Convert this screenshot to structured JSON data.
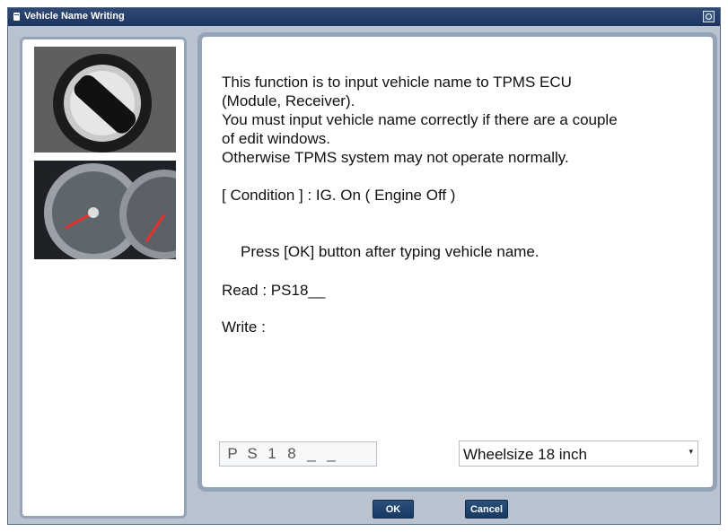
{
  "window": {
    "title": "Vehicle Name Writing",
    "title_icon": "app-icon",
    "close_icon": "close-icon"
  },
  "left_panel": {
    "images": [
      "ignition-switch-image",
      "instrument-cluster-image"
    ]
  },
  "content": {
    "lines": [
      "This function is to input vehicle name to TPMS ECU",
      "(Module, Receiver).",
      "You must input vehicle name correctly if there are a couple",
      "of edit windows.",
      "Otherwise TPMS system may not operate normally."
    ],
    "condition": "[ Condition ] : IG. On ( Engine Off )",
    "instruction": "Press [OK] button after typing vehicle name.",
    "read": "Read : PS18__",
    "write": "Write :"
  },
  "input": {
    "chars": [
      "P",
      "S",
      "1",
      "8",
      "_",
      "_"
    ]
  },
  "select": {
    "value": "Wheelsize 18 inch",
    "arrow": "▾"
  },
  "buttons": {
    "ok": "OK",
    "cancel": "Cancel"
  },
  "colors": {
    "title_bar": "#1c3460",
    "button": "#173a62",
    "panel_border": "#94a3b8"
  }
}
